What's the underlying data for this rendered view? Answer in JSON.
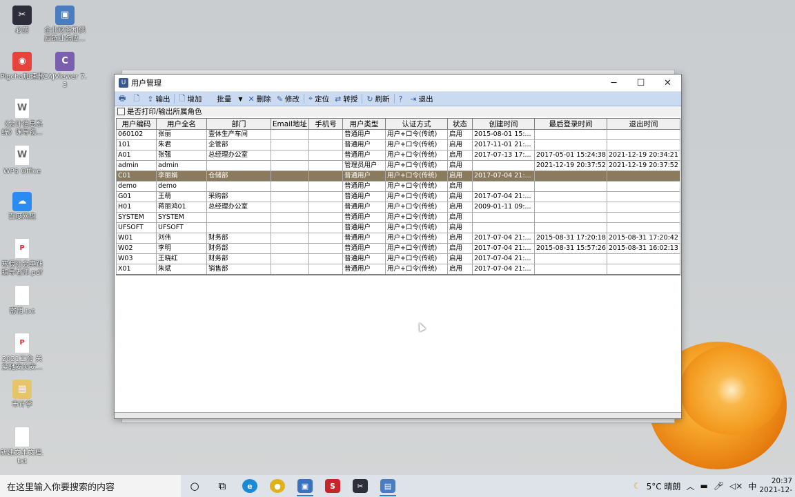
{
  "desktop": {
    "icons": [
      {
        "label": "必剪",
        "glyph": "✂",
        "color": "#2e2e3a",
        "icon": "scissors-app-icon"
      },
      {
        "label": "企业财务和供应链业务应...",
        "glyph": "▣",
        "color": "#4a7cc0",
        "icon": "erp-shortcut-icon"
      },
      {
        "label": "Pigcha加速器",
        "glyph": "◉",
        "color": "#e8423a",
        "icon": "pigcha-icon"
      },
      {
        "label": "CAJViewer 7.3",
        "glyph": "C",
        "color": "#7a5fb0",
        "icon": "cajviewer-icon"
      },
      {
        "label": "《会计信息系统》课导视...",
        "glyph": "W",
        "color": "doc",
        "icon": "word-doc-icon"
      },
      {
        "label": "WPS Office",
        "glyph": "W",
        "color": "doc",
        "icon": "wps-doc-icon"
      },
      {
        "label": "百度网盘",
        "glyph": "☁",
        "color": "#2a8bf2",
        "icon": "baidu-netdisk-icon"
      },
      {
        "label": "寒假社会实践指导老师.pdf",
        "glyph": "P",
        "color": "pdf",
        "icon": "pdf-file-icon"
      },
      {
        "label": "密钥.txt",
        "glyph": "",
        "color": "doc",
        "icon": "txt-file-icon"
      },
      {
        "label": "2021工会 关爱驰安关安...",
        "glyph": "P",
        "color": "pdf",
        "icon": "pdf-file-icon-2"
      },
      {
        "label": "市计学",
        "glyph": "▤",
        "color": "#e6c46a",
        "icon": "folder-icon"
      },
      {
        "label": "新建文本文档.txt",
        "glyph": "",
        "color": "doc",
        "icon": "new-txt-file-icon"
      }
    ]
  },
  "window": {
    "title": "用户管理",
    "min": "─",
    "max": "☐",
    "close": "✕",
    "toolbar": [
      {
        "label": "",
        "icon": "print-icon",
        "glyph": "🖶"
      },
      {
        "label": "",
        "icon": "preview-icon",
        "glyph": "🗋"
      },
      {
        "label": "输出",
        "icon": "export-icon",
        "glyph": "⇪"
      },
      {
        "label": "增加",
        "icon": "add-icon",
        "glyph": "🗋"
      },
      {
        "label": "批量",
        "icon": "batch-icon",
        "glyph": ""
      },
      {
        "label": "删除",
        "icon": "delete-icon",
        "glyph": "✕"
      },
      {
        "label": "修改",
        "icon": "edit-icon",
        "glyph": "✎"
      },
      {
        "label": "定位",
        "icon": "locate-icon",
        "glyph": "⌖"
      },
      {
        "label": "转授",
        "icon": "delegate-icon",
        "glyph": "⇄"
      },
      {
        "label": "刷新",
        "icon": "refresh-icon",
        "glyph": "↻"
      },
      {
        "label": "",
        "icon": "help-icon",
        "glyph": "?"
      },
      {
        "label": "退出",
        "icon": "exit-icon",
        "glyph": "⇥"
      }
    ],
    "option_label": "是否打印/输出所属角色",
    "columns": [
      "用户编码",
      "用户全名",
      "部门",
      "Email地址",
      "手机号",
      "用户类型",
      "认证方式",
      "状态",
      "创建时间",
      "最后登录时间",
      "退出时间"
    ],
    "rows": [
      [
        "060102",
        "张丽",
        "壹体生产车间",
        "",
        "",
        "普通用户",
        "用户+口令(传统)",
        "启用",
        "2015-08-01 15:...",
        "",
        ""
      ],
      [
        "101",
        "朱君",
        "企管部",
        "",
        "",
        "普通用户",
        "用户+口令(传统)",
        "启用",
        "2017-11-01 21:...",
        "",
        ""
      ],
      [
        "A01",
        "张强",
        "总经理办公室",
        "",
        "",
        "普通用户",
        "用户+口令(传统)",
        "启用",
        "2017-07-13 17:...",
        "2017-05-01 15:24:38",
        "2021-12-19 20:34:21"
      ],
      [
        "admin",
        "admin",
        "",
        "",
        "",
        "管理员用户",
        "用户+口令(传统)",
        "启用",
        "",
        "2021-12-19 20:37:52",
        "2021-12-19 20:37:52"
      ],
      [
        "C01",
        "李丽娟",
        "仓储部",
        "",
        "",
        "普通用户",
        "用户+口令(传统)",
        "启用",
        "2017-07-04 21:...",
        "",
        ""
      ],
      [
        "demo",
        "demo",
        "",
        "",
        "",
        "普通用户",
        "用户+口令(传统)",
        "启用",
        "",
        "",
        ""
      ],
      [
        "G01",
        "王萌",
        "采购部",
        "",
        "",
        "普通用户",
        "用户+口令(传统)",
        "启用",
        "2017-07-04 21:...",
        "",
        ""
      ],
      [
        "H01",
        "蒋丽鸿01",
        "总经理办公室",
        "",
        "",
        "普通用户",
        "用户+口令(传统)",
        "启用",
        "2009-01-11 09:...",
        "",
        ""
      ],
      [
        "SYSTEM",
        "SYSTEM",
        "",
        "",
        "",
        "普通用户",
        "用户+口令(传统)",
        "启用",
        "",
        "",
        ""
      ],
      [
        "UFSOFT",
        "UFSOFT",
        "",
        "",
        "",
        "普通用户",
        "用户+口令(传统)",
        "启用",
        "",
        "",
        ""
      ],
      [
        "W01",
        "刘伟",
        "财务部",
        "",
        "",
        "普通用户",
        "用户+口令(传统)",
        "启用",
        "2017-07-04 21:...",
        "2015-08-31 17:20:18",
        "2015-08-31 17:20:42"
      ],
      [
        "W02",
        "李明",
        "财务部",
        "",
        "",
        "普通用户",
        "用户+口令(传统)",
        "启用",
        "2017-07-04 21:...",
        "2015-08-31 15:57:26",
        "2015-08-31 16:02:13"
      ],
      [
        "W03",
        "王晓红",
        "财务部",
        "",
        "",
        "普通用户",
        "用户+口令(传统)",
        "启用",
        "2017-07-04 21:...",
        "",
        ""
      ],
      [
        "X01",
        "朱斌",
        "销售部",
        "",
        "",
        "普通用户",
        "用户+口令(传统)",
        "启用",
        "2017-07-04 21:...",
        "",
        ""
      ]
    ],
    "selected_row": 4
  },
  "taskbar": {
    "search_placeholder": "在这里输入你要搜索的内容",
    "weather": "5°C 晴朗",
    "ime": "中",
    "time": "20:37",
    "date": "2021-12-"
  }
}
